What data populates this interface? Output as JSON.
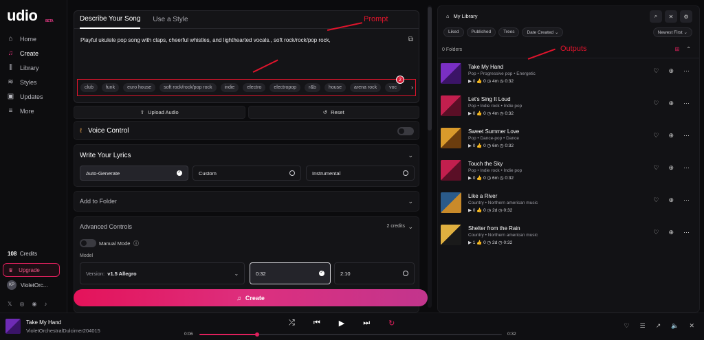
{
  "brand": {
    "logo": "udio",
    "beta": "BETA"
  },
  "nav": [
    {
      "label": "Home",
      "icon": "home-icon",
      "glyph": "⌂"
    },
    {
      "label": "Create",
      "icon": "music-note-icon",
      "glyph": "♫",
      "active": true
    },
    {
      "label": "Library",
      "icon": "library-icon",
      "glyph": "⫼"
    },
    {
      "label": "Styles",
      "icon": "styles-icon",
      "glyph": "≋"
    },
    {
      "label": "Updates",
      "icon": "updates-icon",
      "glyph": "▣"
    },
    {
      "label": "More",
      "icon": "menu-icon",
      "glyph": "≡"
    }
  ],
  "sidebar": {
    "credits_count": "108",
    "credits_label": "Credits",
    "upgrade": "Upgrade",
    "user_initials": "KP",
    "user_name": "VioletOrc..."
  },
  "create": {
    "tab_describe": "Describe Your Song",
    "tab_style": "Use a Style",
    "prompt_text": "Playful ukulele pop song with claps, cheerful whistles, and lighthearted vocals., soft rock/rock/pop rock,",
    "tags": [
      "club",
      "funk",
      "euro house",
      "soft rock/rock/pop rock",
      "indie",
      "electro",
      "electropop",
      "r&b",
      "house",
      "arena rock",
      "voc"
    ],
    "tags_badge": "2",
    "upload_audio": "Upload Audio",
    "reset": "Reset",
    "voice_control": "Voice Control",
    "lyrics_title": "Write Your Lyrics",
    "lyrics_options": [
      "Auto-Generate",
      "Custom",
      "Instrumental"
    ],
    "add_to_folder": "Add to Folder",
    "advanced_title": "Advanced Controls",
    "advanced_credits": "2 credits",
    "manual_mode": "Manual Mode",
    "model_label": "Model",
    "version_label": "Version:",
    "version_value": "v1.5 Allegro",
    "durations": [
      "0:32",
      "2:10"
    ],
    "create_button": "Create"
  },
  "annotations": {
    "prompt": "Prompt",
    "outputs": "Outputs"
  },
  "library": {
    "title": "My Library",
    "filters": [
      "Liked",
      "Published",
      "Trees",
      "Date Created ⌄"
    ],
    "sort": "Newest First ⌄",
    "folders": "0 Folders",
    "songs": [
      {
        "title": "Take My Hand",
        "tags": "Pop  •  Progressive pop  •  Energetic",
        "stats": "▶ 0   👍 0   ◷ 4m   ◷ 0:32",
        "c1": "#7a2fc4",
        "c2": "#3b1466"
      },
      {
        "title": "Let's Sing It Loud",
        "tags": "Pop  •  Indie rock  •  Indie pop",
        "stats": "▶ 0   👍 0   ◷ 4m   ◷ 0:32",
        "c1": "#c21f4e",
        "c2": "#5a0f26"
      },
      {
        "title": "Sweet Summer Love",
        "tags": "Pop  •  Dance-pop  •  Dance",
        "stats": "▶ 0   👍 0   ◷ 6m   ◷ 0:32",
        "c1": "#d99a2b",
        "c2": "#6b3d0e"
      },
      {
        "title": "Touch the Sky",
        "tags": "Pop  •  Indie rock  •  Indie pop",
        "stats": "▶ 0   👍 0   ◷ 6m   ◷ 0:32",
        "c1": "#c21f4e",
        "c2": "#5a0f26"
      },
      {
        "title": "Like a River",
        "tags": "Country  •  Northern american music",
        "stats": "▶ 0   👍 0   ◷ 2d   ◷ 0:32",
        "c1": "#2a5a8a",
        "c2": "#c98a2a"
      },
      {
        "title": "Shelter from the Rain",
        "tags": "Country  •  Northern american music",
        "stats": "▶ 1   👍 0   ◷ 2d   ◷ 0:32",
        "c1": "#e0b040",
        "c2": "#1a1a1a"
      }
    ]
  },
  "player": {
    "title": "Take My Hand",
    "artist": "VioletOrchestralDulcimer204015",
    "elapsed": "0:06",
    "duration": "0:32",
    "progress": 0.19
  }
}
